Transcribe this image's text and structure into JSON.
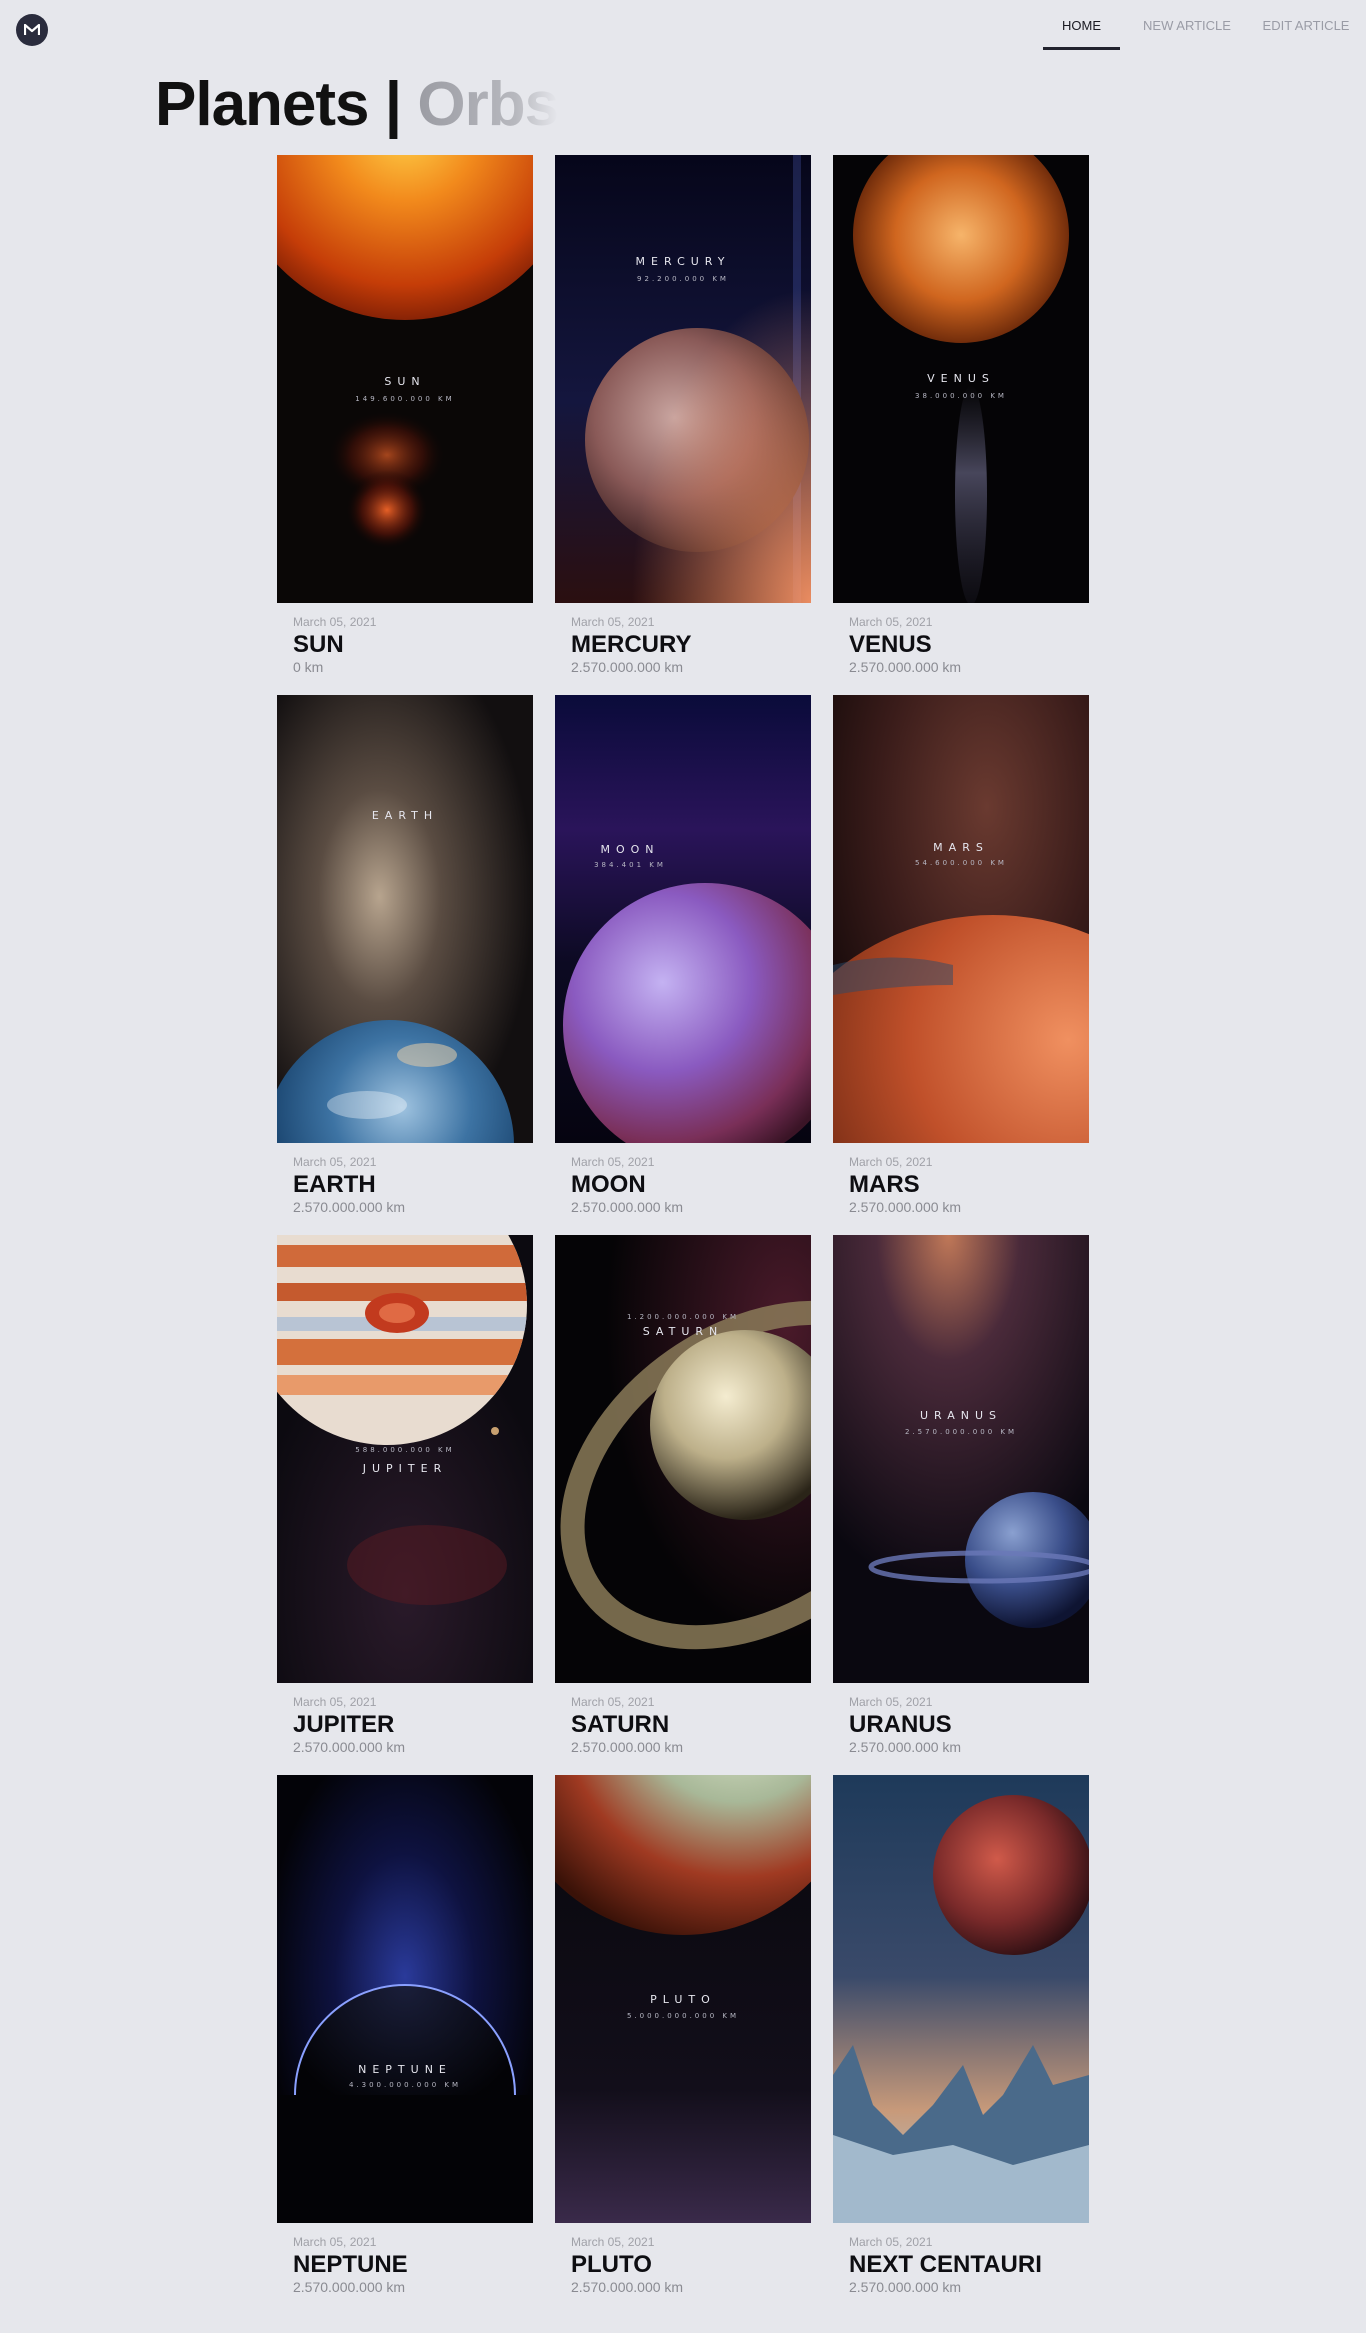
{
  "logo": {
    "letter": "M"
  },
  "nav": {
    "home": "HOME",
    "new_article": "NEW ARTICLE",
    "edit_article": "EDIT ARTICLE"
  },
  "page": {
    "title_main": "Planets",
    "title_sep": "|",
    "title_sub": "Orbs"
  },
  "cards": [
    {
      "date": "March 05, 2021",
      "name": "SUN",
      "distance": "0 km",
      "poster_title": "SUN",
      "poster_dist": "149.600.000 KM"
    },
    {
      "date": "March 05, 2021",
      "name": "MERCURY",
      "distance": "2.570.000.000 km",
      "poster_title": "MERCURY",
      "poster_dist": "92.200.000 KM"
    },
    {
      "date": "March 05, 2021",
      "name": "VENUS",
      "distance": "2.570.000.000 km",
      "poster_title": "VENUS",
      "poster_dist": "38.000.000 KM"
    },
    {
      "date": "March 05, 2021",
      "name": "EARTH",
      "distance": "2.570.000.000 km",
      "poster_title": "EARTH",
      "poster_dist": ""
    },
    {
      "date": "March 05, 2021",
      "name": "MOON",
      "distance": "2.570.000.000 km",
      "poster_title": "MOON",
      "poster_dist": "384.401 KM"
    },
    {
      "date": "March 05, 2021",
      "name": "MARS",
      "distance": "2.570.000.000 km",
      "poster_title": "MARS",
      "poster_dist": "54.600.000 KM"
    },
    {
      "date": "March 05, 2021",
      "name": "JUPITER",
      "distance": "2.570.000.000 km",
      "poster_title": "JUPITER",
      "poster_dist": "588.000.000 KM"
    },
    {
      "date": "March 05, 2021",
      "name": "SATURN",
      "distance": "2.570.000.000 km",
      "poster_title": "SATURN",
      "poster_dist": "1.200.000.000 KM"
    },
    {
      "date": "March 05, 2021",
      "name": "URANUS",
      "distance": "2.570.000.000 km",
      "poster_title": "URANUS",
      "poster_dist": "2.570.000.000 KM"
    },
    {
      "date": "March 05, 2021",
      "name": "NEPTUNE",
      "distance": "2.570.000.000 km",
      "poster_title": "NEPTUNE",
      "poster_dist": "4.300.000.000 KM"
    },
    {
      "date": "March 05, 2021",
      "name": "PLUTO",
      "distance": "2.570.000.000 km",
      "poster_title": "PLUTO",
      "poster_dist": "5.000.000.000 KM"
    },
    {
      "date": "March 05, 2021",
      "name": "NEXT CENTAURI",
      "distance": "2.570.000.000 km",
      "poster_title": "",
      "poster_dist": ""
    }
  ]
}
